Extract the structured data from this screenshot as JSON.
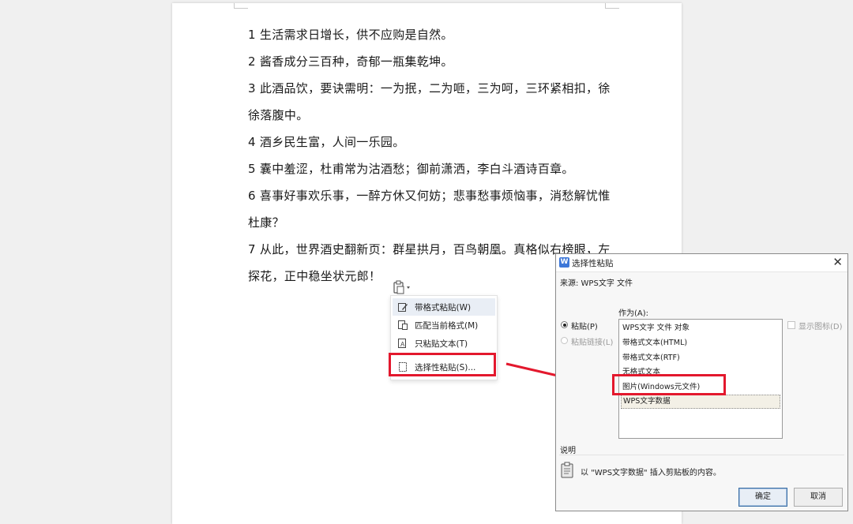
{
  "document": {
    "lines": [
      "1 生活需求日增长，供不应购是自然。",
      "2 酱香成分三百种，奇郁一瓶集乾坤。",
      "3 此酒品饮，要诀需明：一为抿，二为咂，三为呵，三环紧相扣，徐",
      "徐落腹中。",
      "4 酒乡民生富，人间一乐园。",
      "5 囊中羞涩，杜甫常为沽酒愁；御前潇洒，李白斗酒诗百章。",
      "6 喜事好事欢乐事，一醉方休又何妨；悲事愁事烦恼事，消愁解忧惟",
      "杜康？",
      "7 从此，世界酒史翻新页：群星拱月，百鸟朝凰。真格似右榜眼，左",
      "探花，正中稳坐状元郎！"
    ]
  },
  "paste_menu": {
    "items": [
      {
        "label": "带格式粘贴(W)",
        "icon": "paste-formatted-icon"
      },
      {
        "label": "匹配当前格式(M)",
        "icon": "paste-match-icon"
      },
      {
        "label": "只粘贴文本(T)",
        "icon": "paste-text-icon"
      },
      {
        "label": "选择性粘贴(S)...",
        "icon": "paste-special-icon"
      }
    ]
  },
  "dialog": {
    "title": "选择性粘贴",
    "source_label": "来源: WPS文字 文件",
    "as_label": "作为(A):",
    "radio_paste": "粘贴(P)",
    "radio_paste_link": "粘贴链接(L)",
    "show_icon_label": "显示图标(D)",
    "options": [
      "WPS文字 文件 对象",
      "带格式文本(HTML)",
      "带格式文本(RTF)",
      "无格式文本",
      "图片(Windows元文件)",
      "WPS文字数据"
    ],
    "selected_option": "WPS文字数据",
    "description_label": "说明",
    "description_text": "以 \"WPS文字数据\" 插入剪贴板的内容。",
    "ok_label": "确定",
    "cancel_label": "取消"
  },
  "colors": {
    "highlight_red": "#e3182d",
    "dialog_bg": "#f7f7f7",
    "wps_blue": "#3d77d8"
  }
}
